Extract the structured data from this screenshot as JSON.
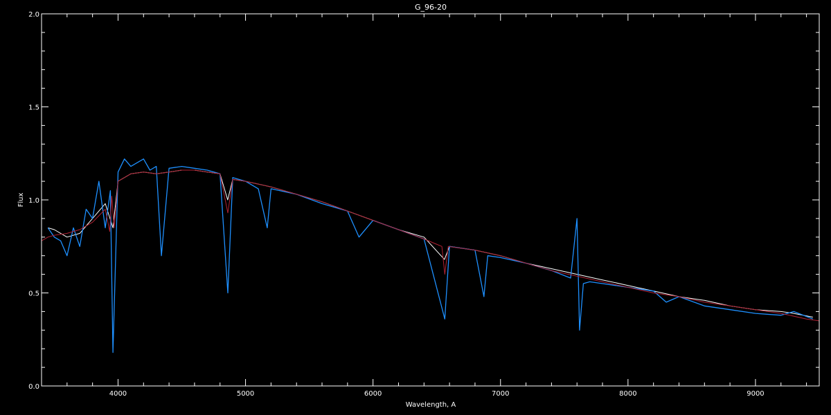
{
  "chart_data": {
    "type": "line",
    "title": "G_96-20",
    "xlabel": "Wavelength, A",
    "ylabel": "Flux",
    "xlim": [
      3400,
      9500
    ],
    "ylim": [
      0.0,
      2.0
    ],
    "x_ticks": [
      4000,
      5000,
      6000,
      7000,
      8000,
      9000
    ],
    "x_tick_labels": [
      "4000",
      "5000",
      "6000",
      "7000",
      "8000",
      "9000"
    ],
    "y_ticks": [
      0.0,
      0.5,
      1.0,
      1.5,
      2.0
    ],
    "y_tick_labels": [
      "0.0",
      "0.5",
      "1.0",
      "1.5",
      "2.0"
    ],
    "grid": false,
    "background": "#000000",
    "axis_color": "#ffffff",
    "series": [
      {
        "color": "#ffffff",
        "x": [
          3450,
          3500,
          3600,
          3700,
          3800,
          3900,
          3960,
          4000,
          4100,
          4200,
          4300,
          4400,
          4500,
          4600,
          4700,
          4800,
          4860,
          4900,
          5000,
          5200,
          5400,
          5600,
          5800,
          6000,
          6200,
          6400,
          6560,
          6600,
          6800,
          7000,
          7200,
          7400,
          7600,
          7800,
          8000,
          8200,
          8400,
          8600,
          8800,
          9000,
          9200,
          9300,
          9450
        ],
        "y": [
          0.85,
          0.84,
          0.8,
          0.82,
          0.9,
          0.98,
          0.85,
          1.1,
          1.14,
          1.15,
          1.14,
          1.15,
          1.16,
          1.16,
          1.15,
          1.14,
          1.0,
          1.11,
          1.1,
          1.07,
          1.03,
          0.99,
          0.94,
          0.89,
          0.84,
          0.8,
          0.68,
          0.75,
          0.73,
          0.7,
          0.66,
          0.63,
          0.6,
          0.57,
          0.54,
          0.51,
          0.48,
          0.46,
          0.43,
          0.41,
          0.4,
          0.39,
          0.37
        ]
      },
      {
        "color": "#1e90ff",
        "x": [
          3450,
          3500,
          3550,
          3600,
          3650,
          3700,
          3750,
          3800,
          3850,
          3900,
          3940,
          3960,
          4000,
          4050,
          4100,
          4150,
          4200,
          4250,
          4300,
          4340,
          4400,
          4500,
          4600,
          4700,
          4800,
          4861,
          4900,
          5000,
          5100,
          5170,
          5200,
          5400,
          5600,
          5800,
          5890,
          6000,
          6200,
          6400,
          6563,
          6600,
          6800,
          6870,
          6900,
          7000,
          7200,
          7400,
          7550,
          7600,
          7620,
          7650,
          7700,
          7800,
          8000,
          8200,
          8300,
          8400,
          8600,
          8800,
          9000,
          9200,
          9300,
          9450
        ],
        "y": [
          0.85,
          0.8,
          0.78,
          0.7,
          0.85,
          0.75,
          0.95,
          0.9,
          1.1,
          0.85,
          1.05,
          0.18,
          1.15,
          1.22,
          1.18,
          1.2,
          1.22,
          1.16,
          1.18,
          0.7,
          1.17,
          1.18,
          1.17,
          1.16,
          1.14,
          0.5,
          1.12,
          1.1,
          1.06,
          0.85,
          1.06,
          1.03,
          0.98,
          0.94,
          0.8,
          0.89,
          0.84,
          0.79,
          0.36,
          0.75,
          0.73,
          0.48,
          0.7,
          0.69,
          0.66,
          0.62,
          0.58,
          0.9,
          0.3,
          0.55,
          0.56,
          0.55,
          0.53,
          0.51,
          0.45,
          0.48,
          0.43,
          0.41,
          0.39,
          0.38,
          0.4,
          0.36
        ]
      },
      {
        "color": "#b22234",
        "x": [
          3400,
          3450,
          3500,
          3600,
          3700,
          3800,
          3900,
          3935,
          3950,
          3970,
          4000,
          4100,
          4200,
          4300,
          4400,
          4500,
          4600,
          4700,
          4800,
          4861,
          4900,
          5000,
          5200,
          5400,
          5600,
          5800,
          6000,
          6200,
          6400,
          6540,
          6563,
          6590,
          6800,
          7000,
          7200,
          7400,
          7600,
          7800,
          8000,
          8200,
          8400,
          8600,
          8800,
          9000,
          9200,
          9400,
          9500
        ],
        "y": [
          0.78,
          0.8,
          0.81,
          0.82,
          0.84,
          0.88,
          0.95,
          0.83,
          1.02,
          0.85,
          1.1,
          1.14,
          1.15,
          1.14,
          1.15,
          1.16,
          1.16,
          1.15,
          1.14,
          0.93,
          1.11,
          1.1,
          1.07,
          1.03,
          0.99,
          0.94,
          0.89,
          0.84,
          0.79,
          0.75,
          0.6,
          0.75,
          0.73,
          0.7,
          0.66,
          0.62,
          0.59,
          0.56,
          0.53,
          0.5,
          0.48,
          0.45,
          0.43,
          0.41,
          0.39,
          0.36,
          0.35
        ]
      },
      {
        "color": "#1e90ff",
        "x": [
          3400,
          5500,
          7600,
          9500
        ],
        "y": [
          0.0,
          0.0,
          0.0,
          0.0
        ]
      }
    ]
  }
}
